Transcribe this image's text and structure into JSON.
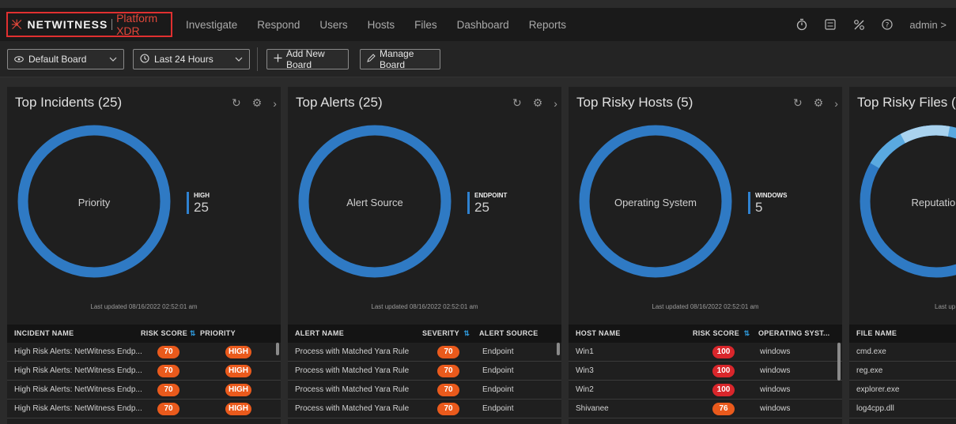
{
  "nav": {
    "brand": "NETWITNESS",
    "product": "Platform XDR",
    "links": [
      "Investigate",
      "Respond",
      "Users",
      "Hosts",
      "Files",
      "Dashboard",
      "Reports"
    ],
    "user": "admin",
    "user_chevron": ">"
  },
  "toolbar": {
    "board": "Default Board",
    "range": "Last 24 Hours",
    "add": "Add New Board",
    "manage": "Manage Board"
  },
  "cards": {
    "incidents": {
      "title": "Top Incidents (25)",
      "center": "Priority",
      "legend_name": "HIGH",
      "legend_value": "25",
      "updated": "Last updated 08/16/2022 02:52:01 am",
      "cols": [
        "INCIDENT NAME",
        "RISK SCORE",
        "PRIORITY"
      ],
      "rows": [
        {
          "name": "High Risk Alerts: NetWitness Endp...",
          "score": "70",
          "priority": "HIGH"
        },
        {
          "name": "High Risk Alerts: NetWitness Endp...",
          "score": "70",
          "priority": "HIGH"
        },
        {
          "name": "High Risk Alerts: NetWitness Endp...",
          "score": "70",
          "priority": "HIGH"
        },
        {
          "name": "High Risk Alerts: NetWitness Endp...",
          "score": "70",
          "priority": "HIGH"
        }
      ]
    },
    "alerts": {
      "title": "Top Alerts (25)",
      "center": "Alert Source",
      "legend_name": "ENDPOINT",
      "legend_value": "25",
      "updated": "Last updated 08/16/2022 02:52:01 am",
      "cols": [
        "ALERT NAME",
        "SEVERITY",
        "ALERT SOURCE"
      ],
      "rows": [
        {
          "name": "Process with Matched Yara Rule",
          "score": "70",
          "source": "Endpoint"
        },
        {
          "name": "Process with Matched Yara Rule",
          "score": "70",
          "source": "Endpoint"
        },
        {
          "name": "Process with Matched Yara Rule",
          "score": "70",
          "source": "Endpoint"
        },
        {
          "name": "Process with Matched Yara Rule",
          "score": "70",
          "source": "Endpoint"
        }
      ]
    },
    "hosts": {
      "title": "Top Risky Hosts (5)",
      "center": "Operating System",
      "legend_name": "WINDOWS",
      "legend_value": "5",
      "updated": "Last updated 08/16/2022 02:52:01 am",
      "cols": [
        "HOST NAME",
        "RISK SCORE",
        "OPERATING SYST..."
      ],
      "rows": [
        {
          "name": "Win1",
          "score": "100",
          "os": "windows"
        },
        {
          "name": "Win3",
          "score": "100",
          "os": "windows"
        },
        {
          "name": "Win2",
          "score": "100",
          "os": "windows"
        },
        {
          "name": "Shivanee",
          "score": "76",
          "os": "windows"
        }
      ]
    },
    "files": {
      "title": "Top Risky Files (25",
      "center": "Reputation",
      "updated": "Last up",
      "cols": [
        "FILE NAME"
      ],
      "rows": [
        "cmd.exe",
        "reg.exe",
        "explorer.exe",
        "log4cpp.dll"
      ]
    }
  },
  "colors": {
    "donut": "#2f7ac4",
    "donut_light": "#a9d2ee",
    "donut_mid": "#5aa9e0",
    "pill_orange": "#ea5a1c",
    "pill_red": "#d9262b",
    "brand_red": "#e03030"
  }
}
